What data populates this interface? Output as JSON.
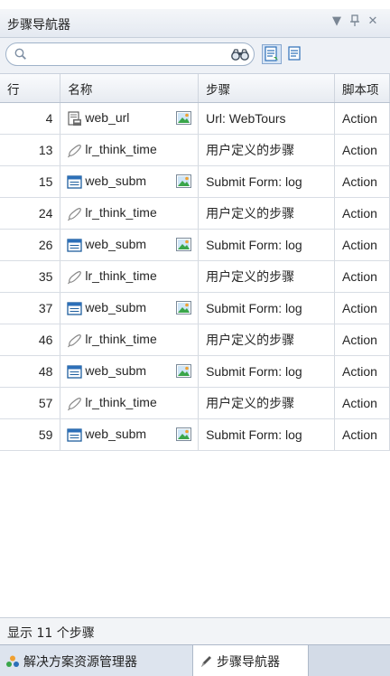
{
  "panel": {
    "title": "步骤导航器",
    "dropdown_glyph": "▼",
    "pin_glyph": "ᛘ",
    "close_glyph": "✕"
  },
  "toolbar": {
    "search_placeholder": "",
    "search_value": "",
    "icons": [
      "search-icon",
      "binoculars-icon",
      "step-view-icon",
      "script-view-icon"
    ]
  },
  "table": {
    "headers": [
      "行",
      "名称",
      "步骤",
      "脚本项"
    ],
    "rows": [
      {
        "line": "4",
        "icon": "url-icon",
        "name": "web_url",
        "thumb": true,
        "step": "Url: WebTours",
        "script": "Action"
      },
      {
        "line": "13",
        "icon": "think-time-icon",
        "name": "lr_think_time",
        "thumb": false,
        "step": "用户定义的步骤",
        "script": "Action"
      },
      {
        "line": "15",
        "icon": "form-icon",
        "name": "web_subm",
        "thumb": true,
        "step": "Submit Form: log",
        "script": "Action"
      },
      {
        "line": "24",
        "icon": "think-time-icon",
        "name": "lr_think_time",
        "thumb": false,
        "step": "用户定义的步骤",
        "script": "Action"
      },
      {
        "line": "26",
        "icon": "form-icon",
        "name": "web_subm",
        "thumb": true,
        "step": "Submit Form: log",
        "script": "Action"
      },
      {
        "line": "35",
        "icon": "think-time-icon",
        "name": "lr_think_time",
        "thumb": false,
        "step": "用户定义的步骤",
        "script": "Action"
      },
      {
        "line": "37",
        "icon": "form-icon",
        "name": "web_subm",
        "thumb": true,
        "step": "Submit Form: log",
        "script": "Action"
      },
      {
        "line": "46",
        "icon": "think-time-icon",
        "name": "lr_think_time",
        "thumb": false,
        "step": "用户定义的步骤",
        "script": "Action"
      },
      {
        "line": "48",
        "icon": "form-icon",
        "name": "web_subm",
        "thumb": true,
        "step": "Submit Form: log",
        "script": "Action"
      },
      {
        "line": "57",
        "icon": "think-time-icon",
        "name": "lr_think_time",
        "thumb": false,
        "step": "用户定义的步骤",
        "script": "Action"
      },
      {
        "line": "59",
        "icon": "form-icon",
        "name": "web_subm",
        "thumb": true,
        "step": "Submit Form: log",
        "script": "Action"
      }
    ]
  },
  "status": {
    "text": "显示 11 个步骤"
  },
  "tabs": [
    {
      "label": "解决方案资源管理器",
      "icon": "solution-explorer-icon",
      "active": false
    },
    {
      "label": "步骤导航器",
      "icon": "step-navigator-icon",
      "active": true
    }
  ],
  "colors": {
    "header_bg": "#e7ebf1",
    "title_bg": "#e4e9f1",
    "accent_blue": "#2c6fb8",
    "thumb_green": "#3aa64a",
    "thumb_orange": "#f0a030"
  }
}
